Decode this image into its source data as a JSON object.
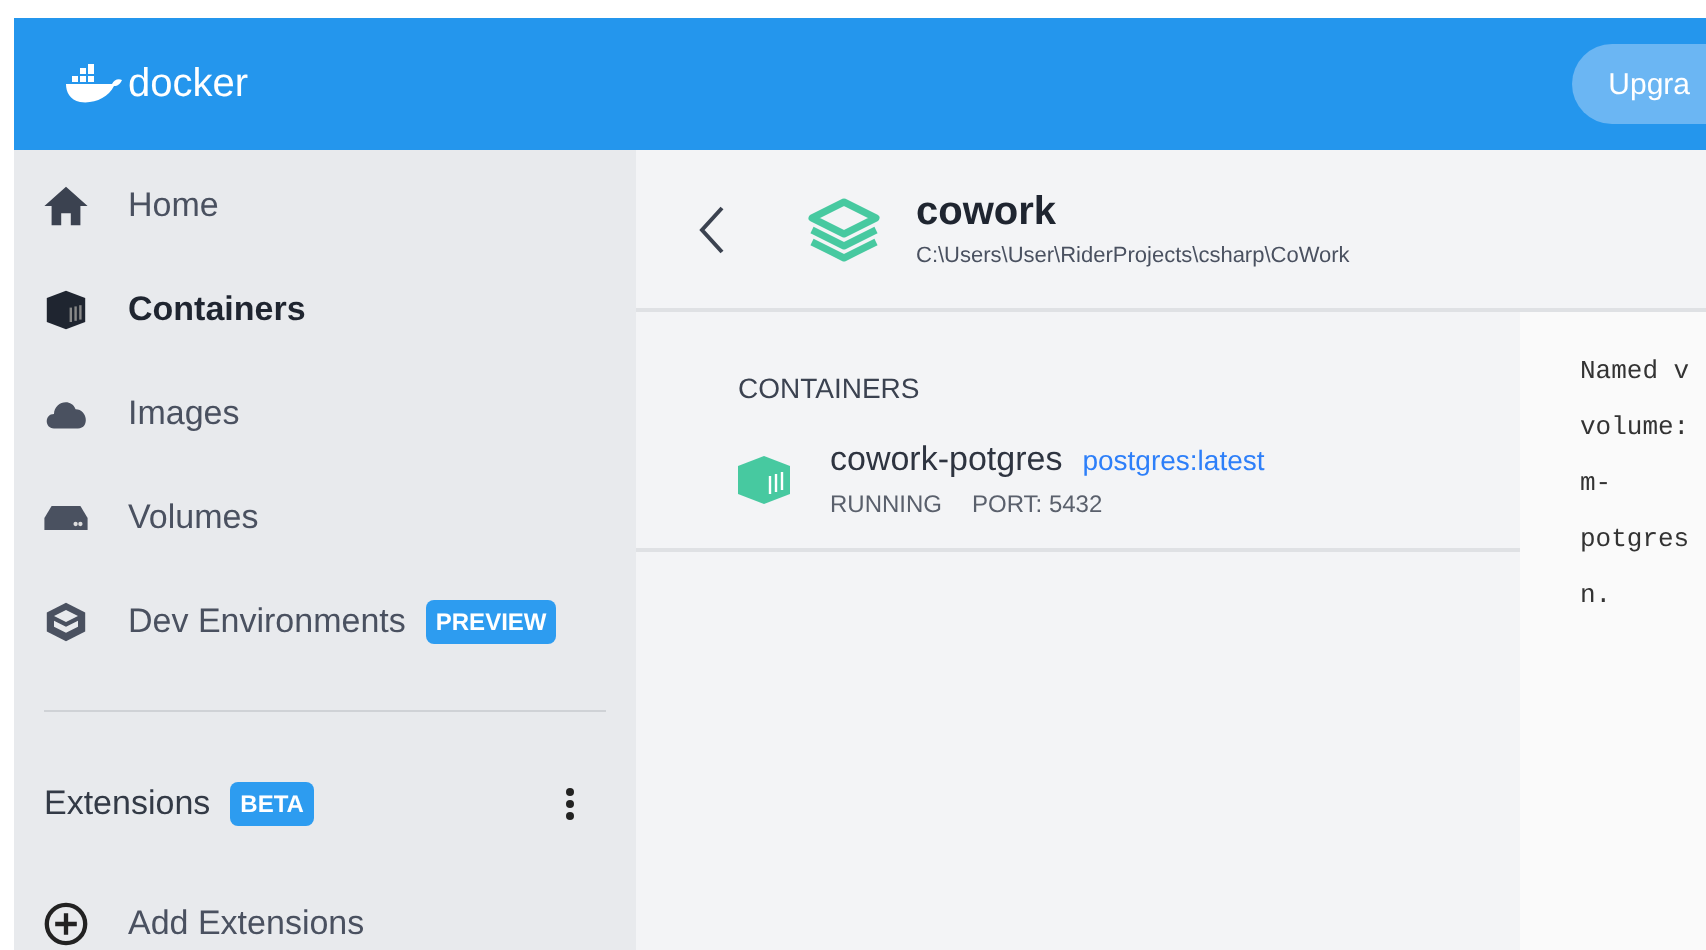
{
  "header": {
    "logo_text": "docker",
    "upgrade_button": "Upgra"
  },
  "sidebar": {
    "items": [
      {
        "label": "Home",
        "kind": "home",
        "selected": false
      },
      {
        "label": "Containers",
        "kind": "container",
        "selected": true
      },
      {
        "label": "Images",
        "kind": "cloud",
        "selected": false
      },
      {
        "label": "Volumes",
        "kind": "drive",
        "selected": false
      },
      {
        "label": "Dev Environments",
        "kind": "box",
        "selected": false,
        "badge": "PREVIEW"
      }
    ],
    "extensions": {
      "label": "Extensions",
      "badge": "BETA"
    },
    "add_extensions": "Add Extensions"
  },
  "project": {
    "name": "cowork",
    "path": "C:\\Users\\User\\RiderProjects\\csharp\\CoWork"
  },
  "containers": {
    "heading": "CONTAINERS",
    "rows": [
      {
        "name": "cowork-potgres",
        "image": "postgres:latest",
        "status": "RUNNING",
        "port": "PORT: 5432"
      }
    ]
  },
  "log_lines": [
    "Named v",
    "volume:",
    "m-",
    "potgres",
    "n."
  ]
}
